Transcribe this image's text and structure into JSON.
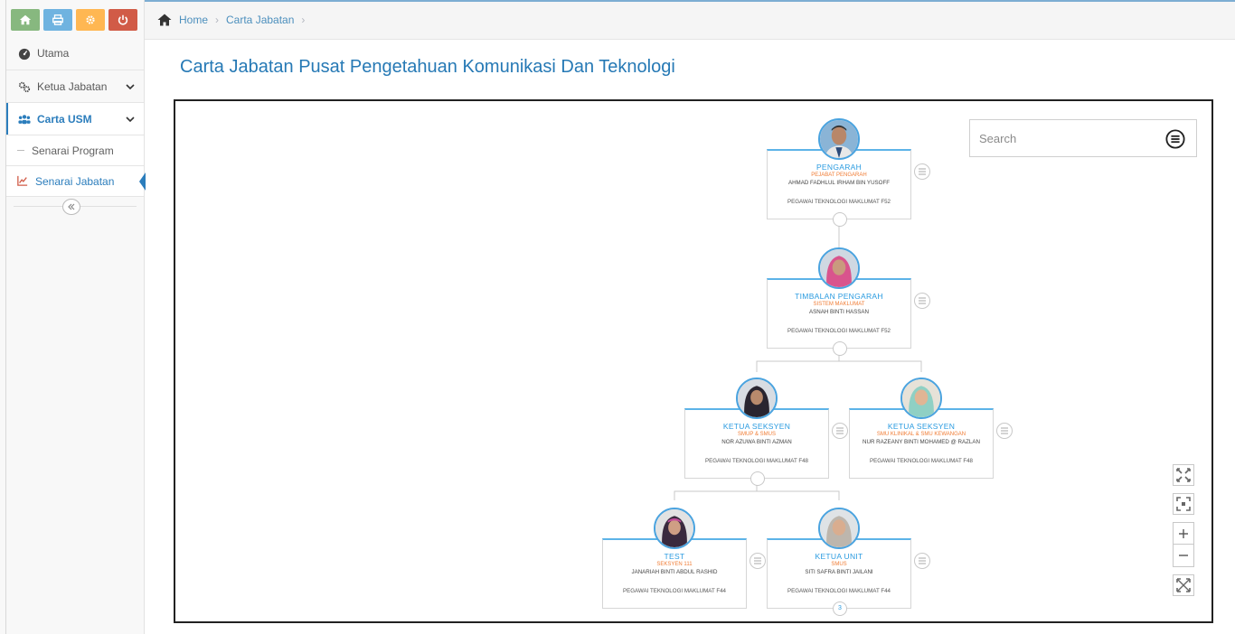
{
  "sidebar": {
    "shortcuts": [
      {
        "icon": "home-icon",
        "color": "#87b87f"
      },
      {
        "icon": "print-icon",
        "color": "#6fb3e0"
      },
      {
        "icon": "gear-icon",
        "color": "#ffb752"
      },
      {
        "icon": "power-icon",
        "color": "#d15b47"
      }
    ],
    "items": [
      {
        "label": "Utama",
        "icon": "dashboard-icon"
      },
      {
        "label": "Ketua Jabatan",
        "icon": "cogs-icon"
      },
      {
        "label": "Carta USM",
        "icon": "users-icon",
        "active": true
      }
    ],
    "subitems": [
      {
        "label": "Senarai Program"
      },
      {
        "label": "Senarai Jabatan",
        "icon": "chart-icon",
        "current": true
      }
    ]
  },
  "breadcrumb": {
    "items": [
      "Home",
      "Carta Jabatan"
    ]
  },
  "page": {
    "title": "Carta Jabatan Pusat Pengetahuan Komunikasi Dan Teknologi"
  },
  "search": {
    "placeholder": "Search"
  },
  "org": {
    "nodes": [
      {
        "role": "PENGARAH",
        "unit": "PEJABAT PENGARAH",
        "name": "AHMAD FADHLUL IRHAM BIN YUSOFF",
        "grade": "PEGAWAI TEKNOLOGI MAKLUMAT F52",
        "photo": "man-photo"
      },
      {
        "role": "TIMBALAN PENGARAH",
        "unit": "SISTEM MAKLUMAT",
        "name": "ASNAH BINTI HASSAN",
        "grade": "PEGAWAI TEKNOLOGI MAKLUMAT F52",
        "photo": "woman-pink-photo"
      },
      {
        "role": "KETUA SEKSYEN",
        "unit": "SMUP & SMUS",
        "name": "NOR AZUWA BINTI AZMAN",
        "grade": "PEGAWAI TEKNOLOGI MAKLUMAT F48",
        "photo": "woman-dark-photo"
      },
      {
        "role": "KETUA SEKSYEN",
        "unit": "SMU KLINIKAL & SMU KEWANGAN",
        "name": "NUR RAZEANY BINTI MOHAMED @ RAZLAN",
        "grade": "PEGAWAI TEKNOLOGI MAKLUMAT F48",
        "photo": "woman-teal-photo"
      },
      {
        "role": "TEST",
        "unit": "SEKSYEN 111",
        "name": "JANARIAH BINTI ABDUL RASHID",
        "grade": "PEGAWAI TEKNOLOGI MAKLUMAT F44",
        "photo": "woman-purple-photo"
      },
      {
        "role": "KETUA UNIT",
        "unit": "SMUS",
        "name": "SITI SAFRA BINTI JAILANI",
        "grade": "PEGAWAI TEKNOLOGI MAKLUMAT F44",
        "photo": "woman-grey-photo",
        "children_count": "3"
      }
    ]
  },
  "colors": {
    "accent": "#2b7dbc",
    "role": "#2a9be0",
    "unit": "#f07b33"
  },
  "zoom_controls": [
    "fit-screen-icon",
    "center-icon",
    "zoom-in-icon",
    "zoom-out-icon",
    "fullscreen-icon"
  ]
}
